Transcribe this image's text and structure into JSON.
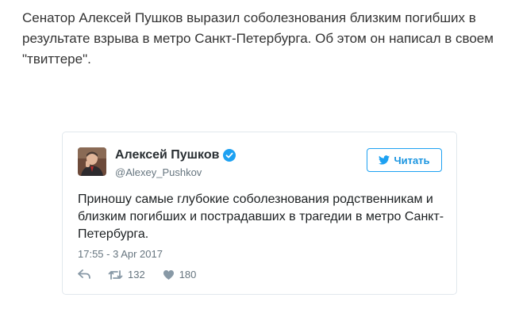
{
  "article": {
    "paragraph": "Сенатор Алексей Пушков выразил соболезнования близким погибших в результате взрыва в метро Санкт-Петербурга. Об этом он написал в своем \"твиттере\"."
  },
  "tweet": {
    "author_name": "Алексей Пушков",
    "author_handle": "@Alexey_Pushkov",
    "follow_label": "Читать",
    "text": "Приношу самые глубокие соболезнования родственникам и близким погибших и пострадавших в трагедии в метро Санкт-Петербурга.",
    "timestamp": "17:55 - 3 Apr 2017",
    "retweet_count": "132",
    "like_count": "180"
  },
  "colors": {
    "twitter_blue": "#1da1f2",
    "muted": "#66757f"
  },
  "icons": [
    "verified-badge-icon",
    "twitter-bird-icon",
    "reply-icon",
    "retweet-icon",
    "heart-icon"
  ]
}
